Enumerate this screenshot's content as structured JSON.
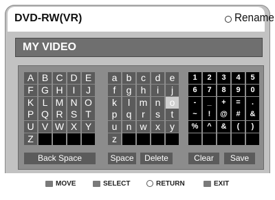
{
  "header": {
    "device": "DVD-RW(VR)",
    "menu_title": "Rename"
  },
  "name_field": {
    "value": "MY VIDEO"
  },
  "keyboard": {
    "upper": [
      [
        "A",
        "B",
        "C",
        "D",
        "E"
      ],
      [
        "F",
        "G",
        "H",
        "I",
        "J"
      ],
      [
        "K",
        "L",
        "M",
        "N",
        "O"
      ],
      [
        "P",
        "Q",
        "R",
        "S",
        "T"
      ],
      [
        "U",
        "V",
        "W",
        "X",
        "Y"
      ],
      [
        "Z",
        "",
        "",
        "",
        ""
      ]
    ],
    "lower": [
      [
        "a",
        "b",
        "c",
        "d",
        "e"
      ],
      [
        "f",
        "g",
        "h",
        "i",
        "j"
      ],
      [
        "k",
        "l",
        "m",
        "n",
        "o"
      ],
      [
        "p",
        "q",
        "r",
        "s",
        "t"
      ],
      [
        "u",
        "n",
        "w",
        "x",
        "y"
      ],
      [
        "z",
        "",
        "",
        "",
        ""
      ]
    ],
    "symbols": [
      [
        "1",
        "2",
        "3",
        "4",
        "5"
      ],
      [
        "6",
        "7",
        "8",
        "9",
        "0"
      ],
      [
        "-",
        "_",
        "+",
        "=",
        "."
      ],
      [
        "~",
        "!",
        "@",
        "#",
        "&"
      ],
      [
        "%",
        "^",
        "&",
        "(",
        ")"
      ],
      [
        "",
        "",
        "",
        "",
        ""
      ]
    ],
    "selected_key": "o",
    "buttons": {
      "backspace": "Back Space",
      "space": "Space",
      "delete": "Delete",
      "clear": "Clear",
      "save": "Save"
    }
  },
  "footer": {
    "move": "MOVE",
    "select": "SELECT",
    "return": "RETURN",
    "exit": "EXIT"
  }
}
